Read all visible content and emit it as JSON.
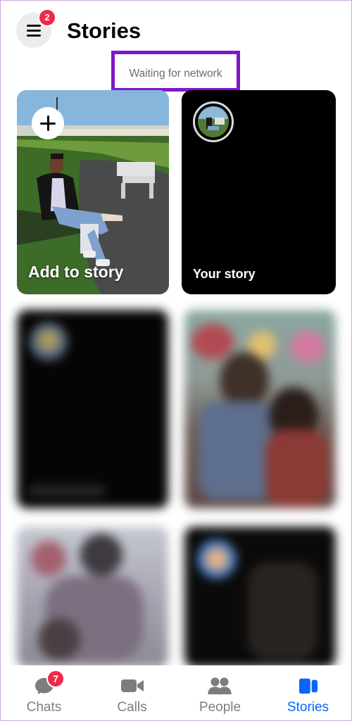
{
  "header": {
    "title": "Stories",
    "menu_badge": "2"
  },
  "status": {
    "network": "Waiting for network"
  },
  "stories": {
    "add_label": "Add to story",
    "your_label": "Your story"
  },
  "nav": {
    "items": [
      {
        "label": "Chats",
        "icon": "chat-bubble-icon",
        "badge": "7",
        "active": false
      },
      {
        "label": "Calls",
        "icon": "video-camera-icon",
        "active": false
      },
      {
        "label": "People",
        "icon": "people-icon",
        "active": false
      },
      {
        "label": "Stories",
        "icon": "stories-icon",
        "active": true
      }
    ]
  },
  "colors": {
    "accent": "#0866ff",
    "badge": "#f0284a",
    "highlight_box": "#8016c9",
    "inactive": "#7d7d7d"
  }
}
